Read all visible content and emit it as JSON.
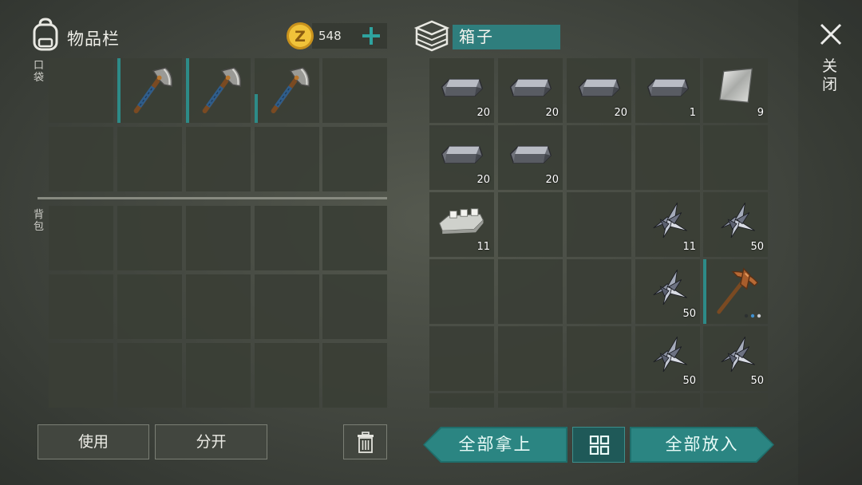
{
  "inventory": {
    "title": "物品栏",
    "coins": "548",
    "pocket_label": "口袋",
    "backpack_label": "背包"
  },
  "container": {
    "name": "箱子"
  },
  "close_label": "关闭",
  "buttons": {
    "use": "使用",
    "split": "分开",
    "take_all": "全部拿上",
    "put_all": "全部放入"
  },
  "pocket_slots": [
    {
      "item": null
    },
    {
      "item": "hatchet-icon",
      "durability": 1.0
    },
    {
      "item": "hatchet-icon",
      "durability": 1.0
    },
    {
      "item": "hatchet-icon",
      "durability": 0.45
    },
    {
      "item": null
    }
  ],
  "box_slots": [
    {
      "item": "iron-bar-icon",
      "count": "20"
    },
    {
      "item": "iron-bar-icon",
      "count": "20"
    },
    {
      "item": "iron-bar-icon",
      "count": "20"
    },
    {
      "item": "iron-bar-icon",
      "count": "1"
    },
    {
      "item": "metal-plate-icon",
      "count": "9"
    },
    {
      "item": "iron-bar-icon",
      "count": "20"
    },
    {
      "item": "iron-bar-icon",
      "count": "20"
    },
    {
      "item": null
    },
    {
      "item": null
    },
    {
      "item": null
    },
    {
      "item": "aluminum-ingot-icon",
      "count": "11"
    },
    {
      "item": null
    },
    {
      "item": null
    },
    {
      "item": "spikes-icon",
      "count": "11"
    },
    {
      "item": "spikes-icon",
      "count": "50"
    },
    {
      "item": null
    },
    {
      "item": null
    },
    {
      "item": null
    },
    {
      "item": "spikes-icon",
      "count": "50"
    },
    {
      "item": "copper-pickaxe-icon",
      "durability": 1.0
    },
    {
      "item": null
    },
    {
      "item": null
    },
    {
      "item": null
    },
    {
      "item": "spikes-icon",
      "count": "50"
    },
    {
      "item": "spikes-icon",
      "count": "50"
    }
  ],
  "colors": {
    "accent": "#2b8582",
    "slot": "#3a3e36",
    "background": "#474b43"
  }
}
